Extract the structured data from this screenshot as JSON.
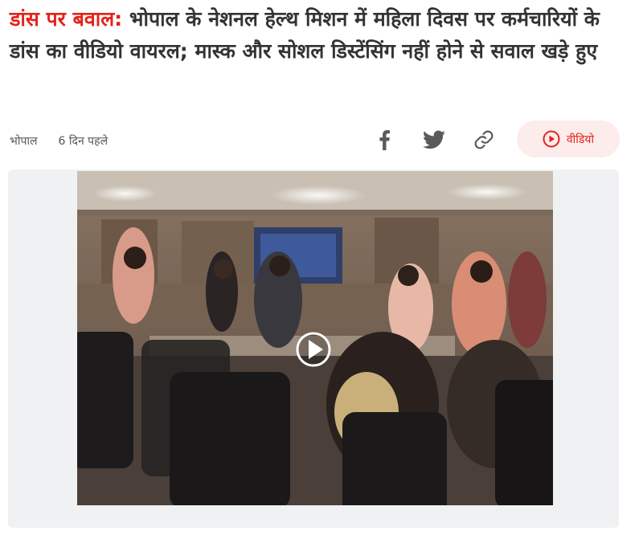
{
  "article": {
    "kicker": "डांस पर बवाल:",
    "headline": "भोपाल के नेशनल हेल्थ मिशन में महिला दिवस पर कर्मचारियों के डांस का वीडियो वायरल; मास्क और सोशल डिस्टेंसिंग नहीं होने से सवाल खड़े हुए"
  },
  "meta": {
    "city": "भोपाल",
    "time": "6 दिन पहले"
  },
  "share": {
    "icons": [
      "facebook-icon",
      "twitter-icon",
      "link-icon"
    ]
  },
  "video_button": {
    "label": "वीडियो",
    "icon": "play-circle-icon"
  },
  "player": {
    "icon": "play-icon"
  },
  "colors": {
    "accent": "#e2231a",
    "pill_bg": "#fdecec",
    "icon_gray": "#5a5a5a"
  }
}
